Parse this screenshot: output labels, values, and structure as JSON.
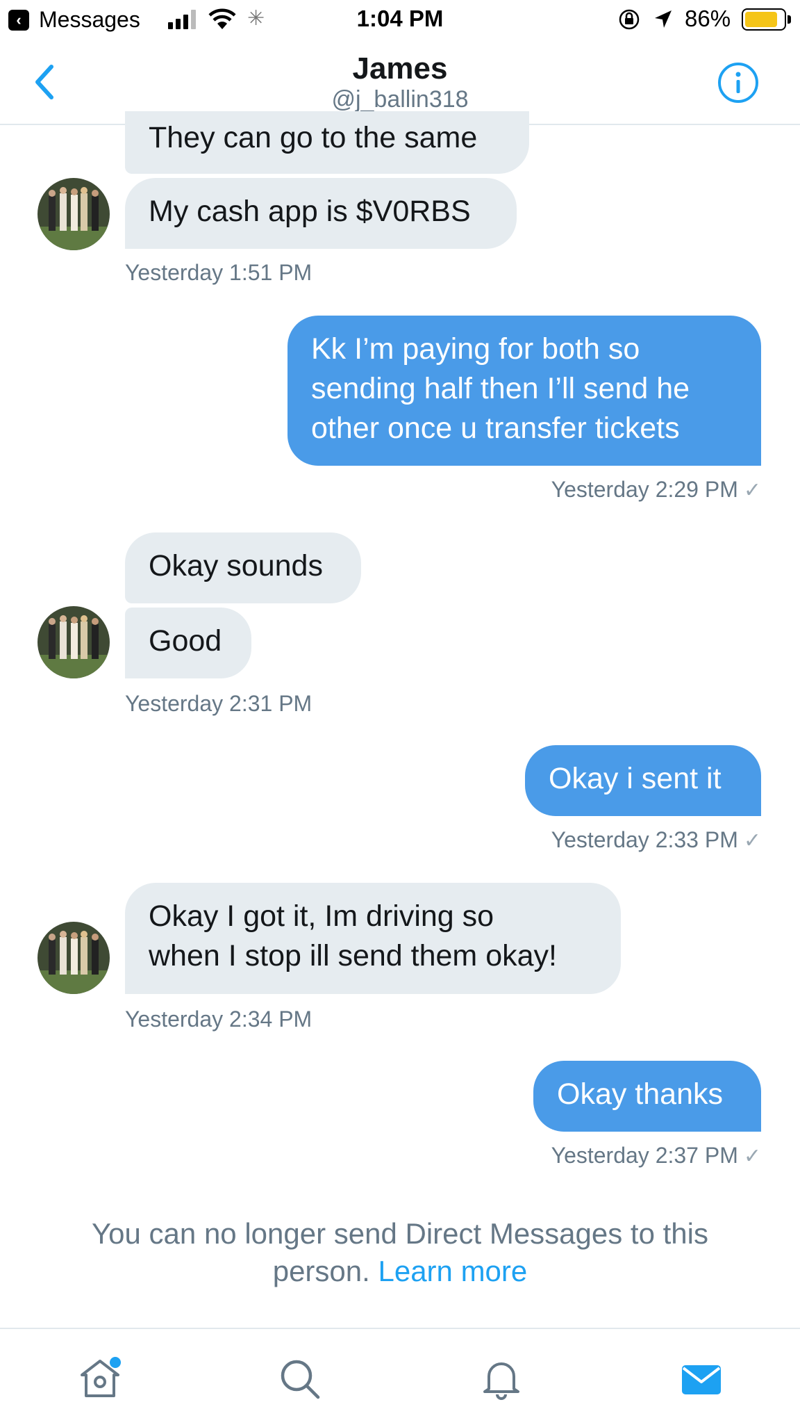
{
  "status_bar": {
    "back_app": "Messages",
    "time": "1:04 PM",
    "battery_percent": "86%",
    "battery_level": 0.86,
    "battery_color": "#f5c518"
  },
  "header": {
    "name": "James",
    "handle": "@j_ballin318",
    "back_icon": "chevron-left-icon",
    "info_icon": "info-icon"
  },
  "messages": [
    {
      "direction": "received",
      "text": "They can go to the same"
    },
    {
      "direction": "received",
      "text": "My cash app is $V0RBS",
      "timestamp": "Yesterday 1:51 PM"
    },
    {
      "direction": "sent",
      "text": "Kk I’m paying for both so\nsending half then I’ll send he\nother once u transfer tickets",
      "timestamp": "Yesterday 2:29 PM"
    },
    {
      "direction": "received",
      "text": "Okay sounds"
    },
    {
      "direction": "received",
      "text": "Good",
      "timestamp": "Yesterday 2:31 PM"
    },
    {
      "direction": "sent",
      "text": "Okay i sent it",
      "timestamp": "Yesterday 2:33 PM"
    },
    {
      "direction": "received",
      "text": "Okay I got it, Im driving so\nwhen I stop ill send them okay!",
      "timestamp": "Yesterday 2:34 PM"
    },
    {
      "direction": "sent",
      "text": "Okay thanks",
      "timestamp": "Yesterday 2:37 PM"
    }
  ],
  "read_mark": "✓",
  "notice": {
    "text": "You can no longer send Direct Messages to this person.",
    "link": "Learn more"
  },
  "tabbar": {
    "tabs": [
      "home-icon",
      "search-icon",
      "notifications-icon",
      "messages-icon"
    ],
    "accent": "#1da1f2"
  },
  "colors": {
    "sent_bubble": "#4a9be8",
    "received_bubble": "#e6ecf0",
    "secondary_text": "#657786"
  }
}
